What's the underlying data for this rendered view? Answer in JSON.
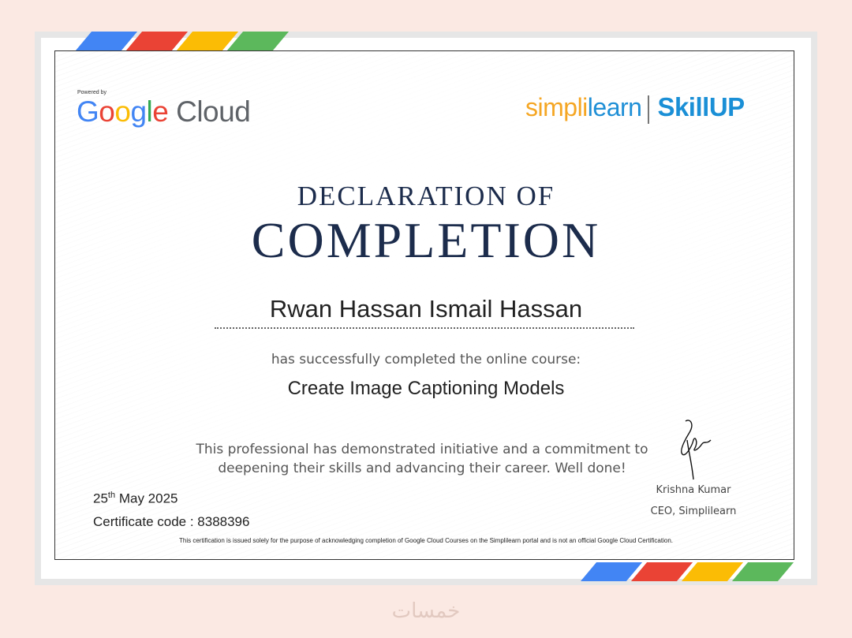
{
  "colors": {
    "blue": "#4285F4",
    "red": "#EA4335",
    "yellow": "#FBBC05",
    "green": "#34A853",
    "navy": "#1c2c4c"
  },
  "header": {
    "powered_by": "Powered by",
    "google_letters": [
      "G",
      "o",
      "o",
      "g",
      "l",
      "e"
    ],
    "cloud": "Cloud",
    "simpli": "simpl",
    "simpli_i": "i",
    "learn": "learn",
    "skill": "Skill",
    "up": "UP"
  },
  "certificate": {
    "title_line1": "DECLARATION OF",
    "title_line2": "COMPLETION",
    "recipient": "Rwan Hassan Ismail Hassan",
    "completed_text": "has successfully completed the online course:",
    "course": "Create Image Captioning Models",
    "message_line1": "This professional has demonstrated initiative and a commitment to",
    "message_line2": "deepening their skills and advancing their career. Well done!",
    "date_day": "25",
    "date_suffix": "th",
    "date_rest": " May 2025",
    "certificate_code": "Certificate code : 8388396",
    "signer_name": "Krishna Kumar",
    "signer_title": "CEO, Simplilearn",
    "disclaimer": "This certification is issued solely for the purpose of acknowledging completion of Google Cloud Courses on the Simplilearn portal and is not an official Google Cloud Certification."
  },
  "watermark": "خمسات"
}
